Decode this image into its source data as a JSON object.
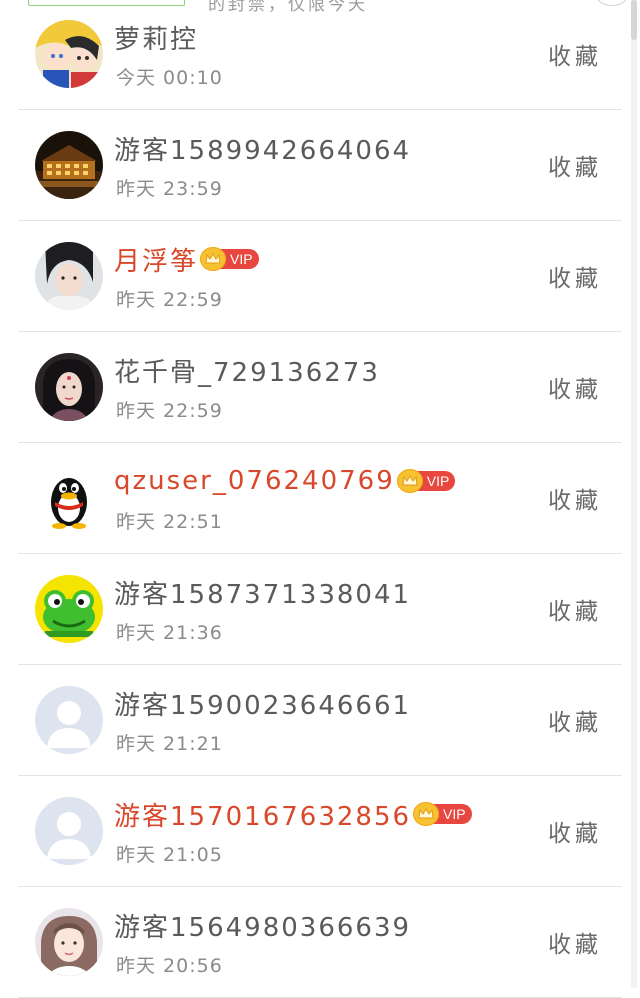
{
  "top_partial_text": "的封禁，仅限今天",
  "favorite_label": "收藏",
  "vip_label": "VIP",
  "items": [
    {
      "name": "萝莉控",
      "time": "今天 00:10",
      "vip": false,
      "avatar": "anime-girls-avatar"
    },
    {
      "name": "游客1589942664064",
      "time": "昨天 23:59",
      "vip": false,
      "avatar": "night-building-avatar"
    },
    {
      "name": "月浮筝",
      "time": "昨天 22:59",
      "vip": true,
      "avatar": "costume-man-avatar"
    },
    {
      "name": "花千骨_729136273",
      "time": "昨天 22:59",
      "vip": false,
      "avatar": "costume-woman-avatar"
    },
    {
      "name": "qzuser_076240769",
      "time": "昨天 22:51",
      "vip": true,
      "avatar": "qq-penguin-avatar"
    },
    {
      "name": "游客1587371338041",
      "time": "昨天 21:36",
      "vip": false,
      "avatar": "green-frog-avatar"
    },
    {
      "name": "游客1590023646661",
      "time": "昨天 21:21",
      "vip": false,
      "avatar": "default-user-avatar"
    },
    {
      "name": "游客1570167632856",
      "time": "昨天 21:05",
      "vip": true,
      "avatar": "default-user-avatar"
    },
    {
      "name": "游客1564980366639",
      "time": "昨天 20:56",
      "vip": false,
      "avatar": "girl-photo-avatar"
    }
  ],
  "colors": {
    "vip_name": "#d9482a",
    "vip_badge": "#e8473f",
    "crown": "#f6c232",
    "divider": "#e3e3e3"
  }
}
